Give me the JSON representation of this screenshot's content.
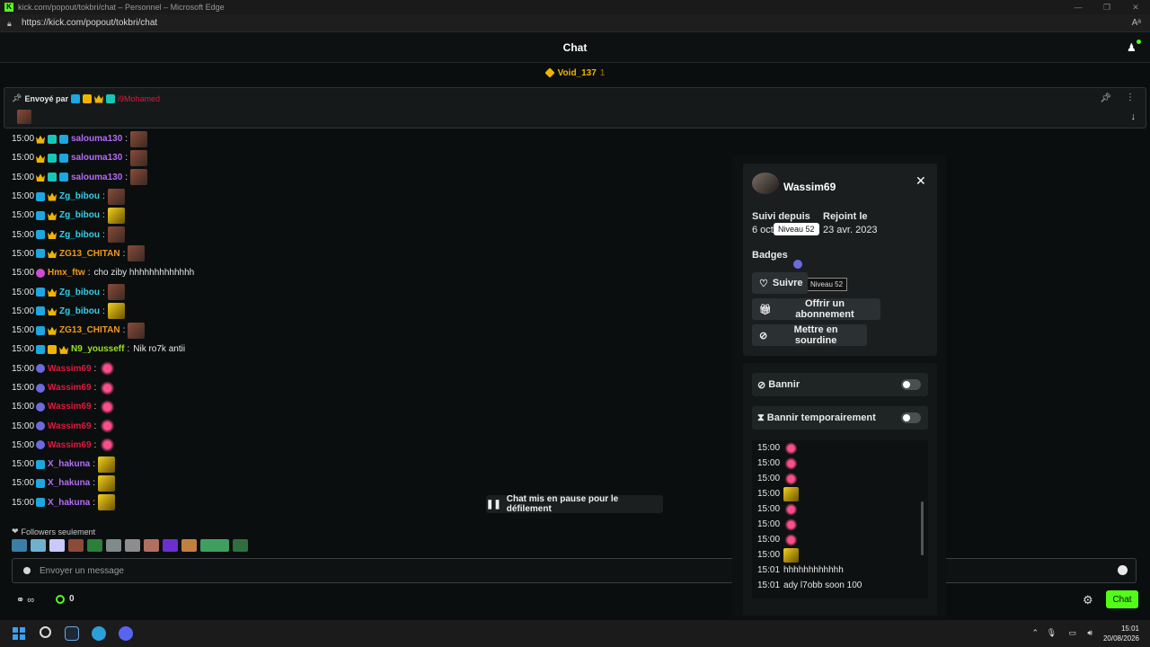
{
  "window": {
    "title": "kick.com/popout/tokbri/chat – Personnel – Microsoft Edge",
    "url": "https://kick.com/popout/tokbri/chat"
  },
  "chat": {
    "header_title": "Chat",
    "top_gifter": {
      "name": "Void_137",
      "count": "1"
    },
    "pinned": {
      "label": "Envoyé par",
      "sender": "i9Mohamed"
    },
    "messages": [
      {
        "time": "15:00",
        "badges": [
          "crown",
          "og",
          "vip"
        ],
        "user": "salouma130",
        "color": "#b36cf6",
        "colon": ":",
        "text": "",
        "emote": "face"
      },
      {
        "time": "15:00",
        "badges": [
          "crown",
          "og",
          "vip"
        ],
        "user": "salouma130",
        "color": "#b36cf6",
        "colon": ":",
        "text": "",
        "emote": "face"
      },
      {
        "time": "15:00",
        "badges": [
          "crown",
          "og",
          "vip"
        ],
        "user": "salouma130",
        "color": "#b36cf6",
        "colon": ":",
        "text": "",
        "emote": "face"
      },
      {
        "time": "15:00",
        "badges": [
          "sub",
          "crown"
        ],
        "user": "Zg_bibou",
        "color": "#33d1e8",
        "colon": ":",
        "text": "",
        "emote": "face"
      },
      {
        "time": "15:00",
        "badges": [
          "sub",
          "crown"
        ],
        "user": "Zg_bibou",
        "color": "#33d1e8",
        "colon": ":",
        "text": "",
        "emote": "gold"
      },
      {
        "time": "15:00",
        "badges": [
          "sub",
          "crown"
        ],
        "user": "Zg_bibou",
        "color": "#33d1e8",
        "colon": ":",
        "text": "",
        "emote": "face"
      },
      {
        "time": "15:00",
        "badges": [
          "sub",
          "crown"
        ],
        "user": "ZG13_CHITAN",
        "color": "#f09a1c",
        "colon": ":",
        "text": "",
        "emote": "face"
      },
      {
        "time": "15:00",
        "badges": [
          "pink"
        ],
        "user": "Hmx_ftw",
        "color": "#f09a1c",
        "colon": ":",
        "text": "cho ziby hhhhhhhhhhhhh",
        "emote": ""
      },
      {
        "time": "15:00",
        "badges": [
          "sub",
          "crown"
        ],
        "user": "Zg_bibou",
        "color": "#33d1e8",
        "colon": ":",
        "text": "",
        "emote": "face"
      },
      {
        "time": "15:00",
        "badges": [
          "sub",
          "crown"
        ],
        "user": "Zg_bibou",
        "color": "#33d1e8",
        "colon": ":",
        "text": "",
        "emote": "gold"
      },
      {
        "time": "15:00",
        "badges": [
          "sub",
          "crown"
        ],
        "user": "ZG13_CHITAN",
        "color": "#f09a1c",
        "colon": ":",
        "text": "",
        "emote": "face"
      },
      {
        "time": "15:00",
        "badges": [
          "sub",
          "k",
          "crown"
        ],
        "user": "N9_yousseff",
        "color": "#9be024",
        "colon": ":",
        "text": "Nik ro7k antii",
        "emote": ""
      },
      {
        "time": "15:00",
        "badges": [
          "level"
        ],
        "user": "Wassim69",
        "color": "#e0183c",
        "colon": ":",
        "text": "",
        "emote": "ribbon"
      },
      {
        "time": "15:00",
        "badges": [
          "level"
        ],
        "user": "Wassim69",
        "color": "#e0183c",
        "colon": ":",
        "text": "",
        "emote": "ribbon"
      },
      {
        "time": "15:00",
        "badges": [
          "level"
        ],
        "user": "Wassim69",
        "color": "#e0183c",
        "colon": ":",
        "text": "",
        "emote": "ribbon"
      },
      {
        "time": "15:00",
        "badges": [
          "level"
        ],
        "user": "Wassim69",
        "color": "#e0183c",
        "colon": ":",
        "text": "",
        "emote": "ribbon"
      },
      {
        "time": "15:00",
        "badges": [
          "level"
        ],
        "user": "Wassim69",
        "color": "#e0183c",
        "colon": ":",
        "text": "",
        "emote": "ribbon"
      },
      {
        "time": "15:00",
        "badges": [
          "sub"
        ],
        "user": "X_hakuna",
        "color": "#b36cf6",
        "colon": ":",
        "text": "",
        "emote": "gold"
      },
      {
        "time": "15:00",
        "badges": [
          "sub"
        ],
        "user": "X_hakuna",
        "color": "#b36cf6",
        "colon": ":",
        "text": "",
        "emote": "gold"
      },
      {
        "time": "15:00",
        "badges": [
          "sub"
        ],
        "user": "X_hakuna",
        "color": "#b36cf6",
        "colon": ":",
        "text": "",
        "emote": "gold"
      }
    ],
    "followers_only": "Followers seulement",
    "paused_label": "Chat mis en pause pour le défilement",
    "input_placeholder": "Envoyer un message",
    "points": "0",
    "send_label": "Chat"
  },
  "user_card": {
    "username": "Wassim69",
    "followed_since_label": "Suivi depuis",
    "followed_since_value": "6 oct",
    "joined_label": "Rejoint le",
    "joined_value": "23 avr. 2023",
    "tooltip_level": "Niveau 52",
    "badges_label": "Badges",
    "badge_tooltip": "Niveau 52",
    "follow_label": "Suivre",
    "gift_label": "Offrir un abonnement",
    "mute_label": "Mettre en sourdine",
    "ban_label": "Bannir",
    "tempban_label": "Bannir temporairement",
    "history": [
      {
        "time": "15:00",
        "text": "",
        "emote": "ribbon"
      },
      {
        "time": "15:00",
        "text": "",
        "emote": "ribbon"
      },
      {
        "time": "15:00",
        "text": "",
        "emote": "ribbon"
      },
      {
        "time": "15:00",
        "text": "",
        "emote": "gold"
      },
      {
        "time": "15:00",
        "text": "",
        "emote": "ribbon"
      },
      {
        "time": "15:00",
        "text": "",
        "emote": "ribbon"
      },
      {
        "time": "15:00",
        "text": "",
        "emote": "ribbon"
      },
      {
        "time": "15:00",
        "text": "",
        "emote": "gold"
      },
      {
        "time": "15:01",
        "text": "hhhhhhhhhhhh",
        "emote": ""
      },
      {
        "time": "15:01",
        "text": "ady l7obb soon 100",
        "emote": ""
      }
    ]
  },
  "taskbar": {
    "time": "15:01",
    "date": "20/08/2026"
  },
  "colors": {
    "accent": "#53fc18",
    "background": "#0b0e0f",
    "card": "#1a1e1f"
  }
}
